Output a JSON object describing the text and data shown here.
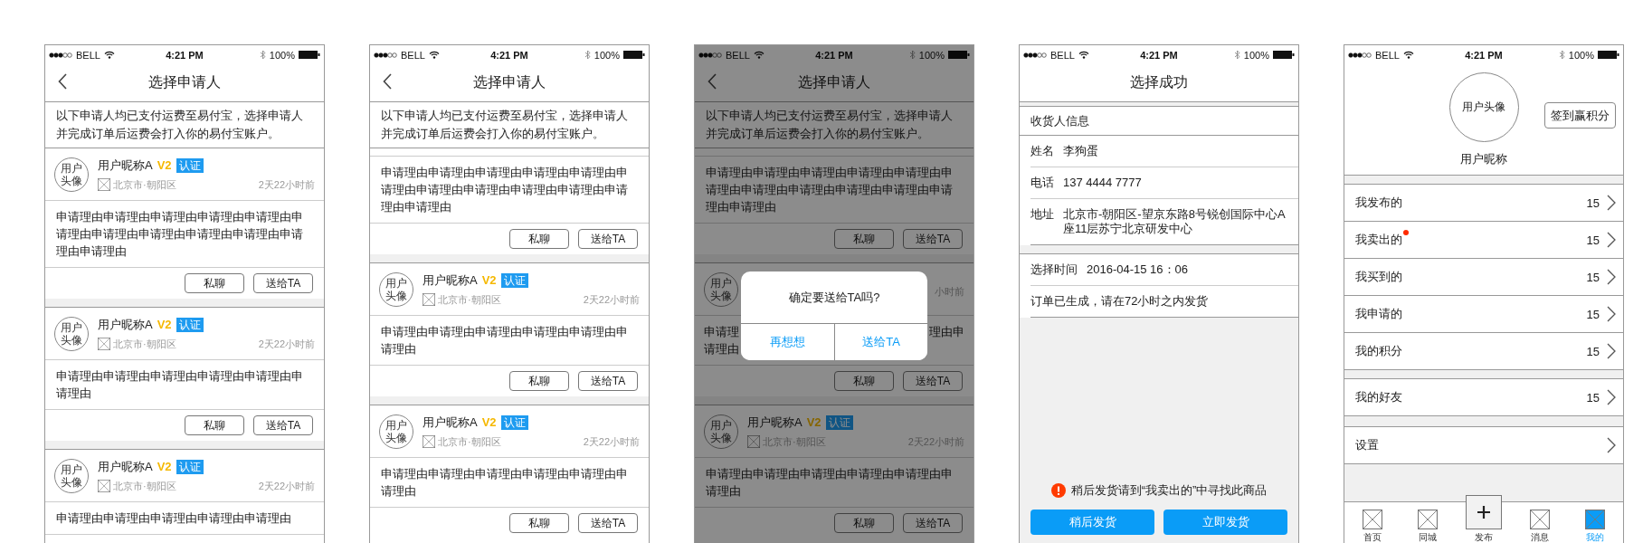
{
  "screens": [
    {
      "kind": "applicant_list",
      "status_bar": {
        "carrier": "BELL",
        "time": "4:21 PM",
        "battery": "100%"
      },
      "title": "选择申请人",
      "back": true,
      "notice": "以下申请人均已支付运费至易付宝，选择申请人并完成订单后运费会打入你的易付宝账户。",
      "cards": [
        {
          "kind": "full",
          "avatar": "用户头像",
          "nickname": "用户昵称A",
          "vip": "V2",
          "verified": "认证",
          "location": "北京市·朝阳区",
          "time": "2天22小时前",
          "reason": "申请理由申请理由申请理由申请理由申请理由申请理由申请理由申请理由申请理由申请理由申请理由申请理由",
          "actions": [
            "私聊",
            "送给TA"
          ]
        },
        {
          "kind": "full",
          "avatar": "用户头像",
          "nickname": "用户昵称A",
          "vip": "V2",
          "verified": "认证",
          "location": "北京市·朝阳区",
          "time": "2天22小时前",
          "reason": "申请理由申请理由申请理由申请理由申请理由申请理由",
          "actions": [
            "私聊",
            "送给TA"
          ]
        },
        {
          "kind": "full",
          "avatar": "用户头像",
          "nickname": "用户昵称A",
          "vip": "V2",
          "verified": "认证",
          "location": "北京市·朝阳区",
          "time": "2天22小时前",
          "reason": "申请理由申请理由申请理由申请理由申请理由"
        }
      ]
    },
    {
      "kind": "applicant_list",
      "status_bar": {
        "carrier": "BELL",
        "time": "4:21 PM",
        "battery": "100%"
      },
      "title": "选择申请人",
      "back": true,
      "notice": "以下申请人均已支付运费至易付宝，选择申请人并完成订单后运费会打入你的易付宝账户。",
      "cards": [
        {
          "kind": "tail",
          "reason": "申请理由申请理由申请理由申请理由申请理由申请理由申请理由申请理由申请理由申请理由申请理由申请理由",
          "actions": [
            "私聊",
            "送给TA"
          ]
        },
        {
          "kind": "full",
          "avatar": "用户头像",
          "nickname": "用户昵称A",
          "vip": "V2",
          "verified": "认证",
          "location": "北京市·朝阳区",
          "time": "2天22小时前",
          "reason": "申请理由申请理由申请理由申请理由申请理由申请理由",
          "actions": [
            "私聊",
            "送给TA"
          ]
        },
        {
          "kind": "full",
          "avatar": "用户头像",
          "nickname": "用户昵称A",
          "vip": "V2",
          "verified": "认证",
          "location": "北京市·朝阳区",
          "time": "2天22小时前",
          "reason": "申请理由申请理由申请理由申请理由申请理由申请理由",
          "actions": [
            "私聊",
            "送给TA"
          ]
        }
      ]
    },
    {
      "kind": "applicant_list",
      "status_bar": {
        "carrier": "BELL",
        "time": "4:21 PM",
        "battery": "100%"
      },
      "title": "选择申请人",
      "back": true,
      "notice": "以下申请人均已支付运费至易付宝，选择申请人并完成订单后运费会打入你的易付宝账户。",
      "cards": [
        {
          "kind": "tail",
          "reason": "申请理由申请理由申请理由申请理由申请理由申请理由申请理由申请理由申请理由申请理由申请理由申请理由",
          "actions": [
            "私聊",
            "送给TA"
          ]
        },
        {
          "kind": "covered",
          "avatar": "用户头像",
          "time": "小时前",
          "reason_lines": [
            [
              "申请理",
              "理由申"
            ],
            [
              "请理由"
            ]
          ],
          "actions": [
            "私聊",
            "送给TA"
          ]
        },
        {
          "kind": "full",
          "avatar": "用户头像",
          "nickname": "用户昵称A",
          "vip": "V2",
          "verified": "认证",
          "location": "北京市·朝阳区",
          "time": "2天22小时前",
          "reason": "申请理由申请理由申请理由申请理由申请理由申请理由",
          "actions": [
            "私聊",
            "送给TA"
          ]
        }
      ],
      "dialog": {
        "message": "确定要送给TA吗?",
        "buttons": [
          "再想想",
          "送给TA"
        ]
      }
    },
    {
      "kind": "order_success",
      "status_bar": {
        "carrier": "BELL",
        "time": "4:21 PM",
        "battery": "100%"
      },
      "title": "选择成功",
      "back": false,
      "section_title": "收货人信息",
      "fields": [
        {
          "label": "姓名",
          "value": "李狗蛋"
        },
        {
          "label": "电话",
          "value": "137 4444 7777"
        },
        {
          "label": "地址",
          "value": "北京市-朝阳区-望京东路8号锐创国际中心A座11层苏宁北京研发中心"
        }
      ],
      "select_time": {
        "label": "选择时间",
        "value": "2016-04-15 16：06"
      },
      "status_text": "订单已生成，请在72小时之内发货",
      "warning": "稍后发货请到“我卖出的”中寻找此商品",
      "buttons": [
        "稍后发货",
        "立即发货"
      ]
    },
    {
      "kind": "profile",
      "status_bar": {
        "carrier": "BELL",
        "time": "4:21 PM",
        "battery": "100%"
      },
      "avatar": "用户头像",
      "nickname": "用户昵称",
      "checkin_button": "签到赢积分",
      "menu_groups": [
        [
          {
            "label": "我发布的",
            "count": "15",
            "dot": false
          },
          {
            "label": "我卖出的",
            "count": "15",
            "dot": true
          },
          {
            "label": "我买到的",
            "count": "15",
            "dot": false
          },
          {
            "label": "我申请的",
            "count": "15",
            "dot": false
          },
          {
            "label": "我的积分",
            "count": "15",
            "dot": false
          }
        ],
        [
          {
            "label": "我的好友",
            "count": "15",
            "dot": false
          }
        ],
        [
          {
            "label": "设置",
            "dot": false
          }
        ]
      ],
      "tabs": [
        {
          "label": "首页",
          "kind": "icon",
          "selected": false
        },
        {
          "label": "同城",
          "kind": "icon",
          "selected": false
        },
        {
          "label": "发布",
          "kind": "publish",
          "selected": false
        },
        {
          "label": "消息",
          "kind": "icon",
          "selected": false
        },
        {
          "label": "我的",
          "kind": "icon",
          "selected": true
        }
      ]
    }
  ]
}
